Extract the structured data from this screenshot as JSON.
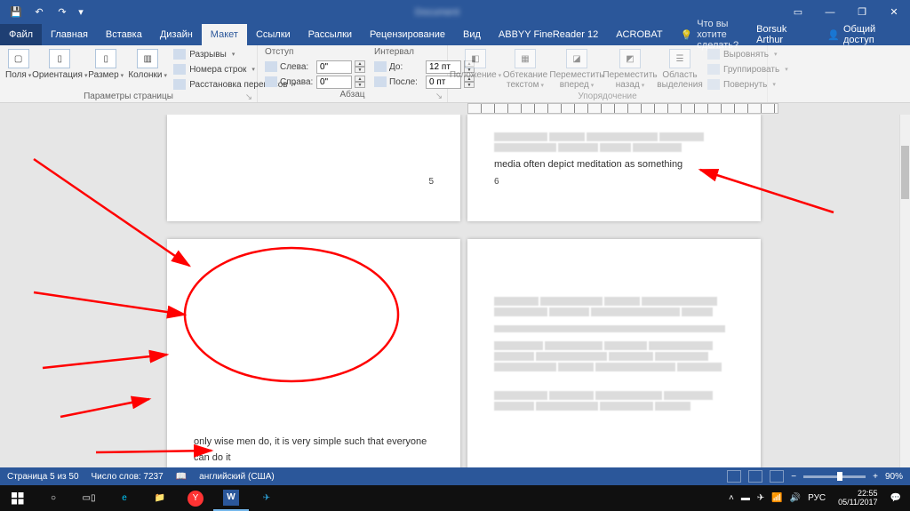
{
  "tabs": {
    "file": "Файл",
    "home": "Главная",
    "insert": "Вставка",
    "design": "Дизайн",
    "layout": "Макет",
    "references": "Ссылки",
    "mailings": "Рассылки",
    "review": "Рецензирование",
    "view": "Вид",
    "abbyy": "ABBYY FineReader 12",
    "acrobat": "ACROBAT"
  },
  "tellMe": "Что вы хотите сделать?",
  "user": "Borsuk Arthur",
  "share": "Общий доступ",
  "ribbon": {
    "pageSetup": {
      "label": "Параметры страницы",
      "margins": "Поля",
      "orientation": "Ориентация",
      "size": "Размер",
      "columns": "Колонки",
      "breaks": "Разрывы",
      "lineNumbers": "Номера строк",
      "hyphenation": "Расстановка переносов"
    },
    "paragraph": {
      "label": "Абзац",
      "indent": "Отступ",
      "spacing": "Интервал",
      "left": "Слева:",
      "right": "Справа:",
      "before": "До:",
      "after": "После:",
      "leftVal": "0\"",
      "rightVal": "0\"",
      "beforeVal": "12 пт",
      "afterVal": "0 пт"
    },
    "arrange": {
      "label": "Упорядочение",
      "position": "Положение",
      "wrapText": "Обтекание текстом",
      "bringForward": "Переместить вперед",
      "sendBackward": "Переместить назад",
      "selectionPane": "Область выделения",
      "align": "Выровнять",
      "group": "Группировать",
      "rotate": "Повернуть"
    }
  },
  "doc": {
    "page5": "5",
    "page6": "6",
    "textTR": "media often depict meditation as something",
    "textBL": "only wise men do, it is very simple such that everyone can do it"
  },
  "status": {
    "page": "Страница 5 из 50",
    "words": "Число слов: 7237",
    "lang": "английский (США)",
    "zoom": "90%"
  },
  "taskbar": {
    "time": "22:55",
    "date": "05/11/2017",
    "lang": "РУС"
  }
}
